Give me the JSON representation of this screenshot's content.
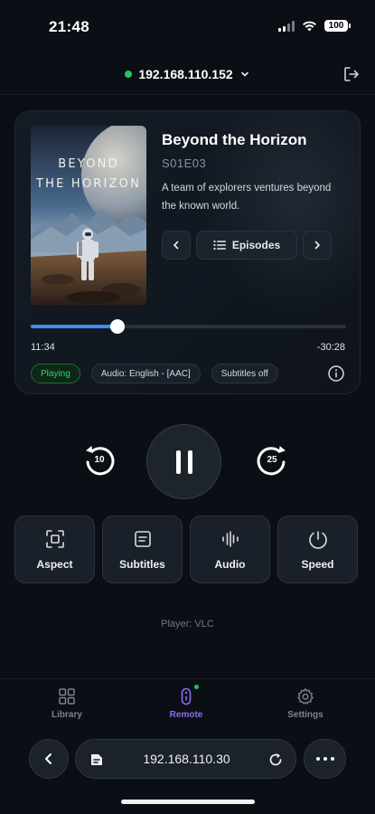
{
  "status_bar": {
    "time": "21:48",
    "battery": "100",
    "icons": [
      "signal-icon",
      "wifi-icon",
      "battery-icon"
    ]
  },
  "connection": {
    "ip": "192.168.110.152",
    "status_color": "#22c55e",
    "icons": [
      "chevron-down-icon",
      "logout-icon"
    ]
  },
  "now_playing": {
    "poster_title_line1": "BEYOND",
    "poster_title_line2": "THE HORIZON",
    "title": "Beyond the Horizon",
    "episode_code": "S01E03",
    "description": "A team of explorers ventures beyond the known world.",
    "episodes_label": "Episodes",
    "elapsed": "11:34",
    "remaining": "-30:28",
    "progress": 0.275,
    "progress_color": "#3b8ef0",
    "chips": {
      "state": "Playing",
      "audio": "Audio: English - [AAC]",
      "subtitles": "Subtitles off"
    }
  },
  "controls": {
    "skip_back_seconds": "10",
    "skip_forward_seconds": "25"
  },
  "options": [
    {
      "label": "Aspect",
      "icon": "aspect-icon"
    },
    {
      "label": "Subtitles",
      "icon": "subtitles-icon"
    },
    {
      "label": "Audio",
      "icon": "audio-icon"
    },
    {
      "label": "Speed",
      "icon": "speed-icon"
    }
  ],
  "player_label": "Player: VLC",
  "tabs": [
    {
      "label": "Library",
      "icon": "grid-icon",
      "active": false
    },
    {
      "label": "Remote",
      "icon": "remote-icon",
      "active": true
    },
    {
      "label": "Settings",
      "icon": "gear-icon",
      "active": false
    }
  ],
  "accent_color": "#8b6cf0",
  "browser": {
    "url": "192.168.110.30"
  }
}
